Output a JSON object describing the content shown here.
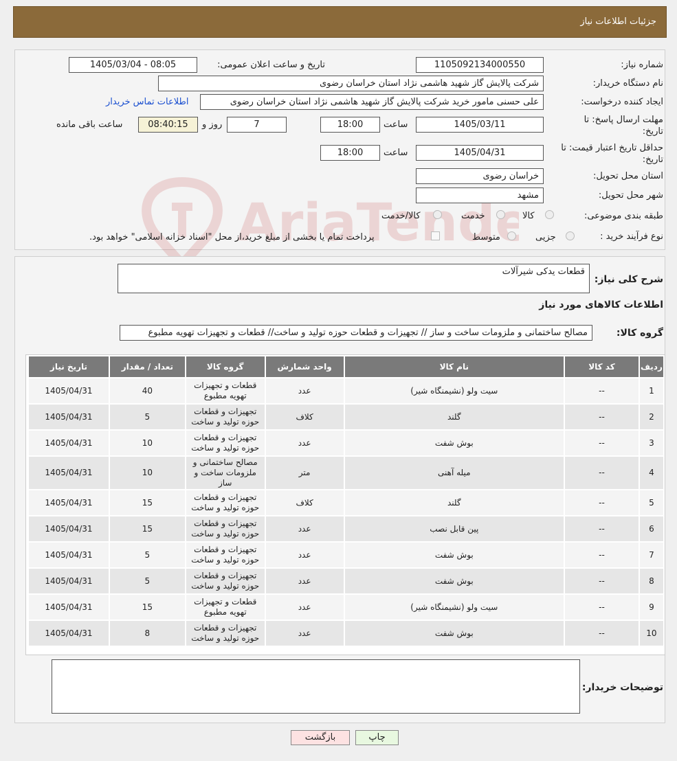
{
  "header": {
    "title": "جزئیات اطلاعات نیاز"
  },
  "info": {
    "need_no_label": "شماره نیاز:",
    "need_no": "1105092134000550",
    "announce_label": "تاریخ و ساعت اعلان عمومی:",
    "announce_value": "1405/03/04 - 08:05",
    "buyer_label": "نام دستگاه خریدار:",
    "buyer_value": "شرکت پالایش گاز شهید هاشمی نژاد   استان خراسان رضوی",
    "creator_label": "ایجاد کننده درخواست:",
    "creator_value": "علی حسنی مامور خرید شرکت پالایش گاز شهید هاشمی نژاد   استان خراسان رضوی",
    "contact_link": "اطلاعات تماس خریدار",
    "deadline_label": "مهلت ارسال پاسخ: تا تاریخ:",
    "deadline_date": "1405/03/11",
    "time_label": "ساعت",
    "deadline_time": "18:00",
    "days_value": "7",
    "days_label": "روز و",
    "remaining_value": "08:40:15",
    "remaining_label": "ساعت باقی مانده",
    "validity_label": "حداقل تاریخ اعتبار قیمت: تا تاریخ:",
    "validity_date": "1405/04/31",
    "validity_time": "18:00",
    "province_label": "استان محل تحویل:",
    "province_value": "خراسان رضوی",
    "city_label": "شهر محل تحویل:",
    "city_value": "مشهد",
    "category_label": "طبقه بندی موضوعی:",
    "category_options": [
      "کالا",
      "خدمت",
      "کالا/خدمت"
    ],
    "process_label": "نوع فرآیند خرید :",
    "process_options": [
      "جزیی",
      "متوسط"
    ],
    "process_note": "پرداخت تمام یا بخشی از مبلغ خرید،از محل \"اسناد خزانه اسلامی\" خواهد بود."
  },
  "general": {
    "desc_label": "شرح کلی نیاز:",
    "desc_value": "قطعات یدکی شیرآلات",
    "items_title": "اطلاعات کالاهای مورد نیاز",
    "group_label": "گروه کالا:",
    "group_value": "مصالح ساختمانی و ملزومات ساخت و ساز // تجهیزات و قطعات حوزه تولید و ساخت//  قطعات و تجهیزات تهویه مطبوع",
    "columns": [
      "ردیف",
      "کد کالا",
      "نام کالا",
      "واحد شمارش",
      "گروه کالا",
      "تعداد / مقدار",
      "تاریخ نیاز"
    ],
    "rows": [
      {
        "n": "1",
        "code": "--",
        "name": "سیت ولو (نشیمنگاه شیر)",
        "unit": "عدد",
        "group": "قطعات و تجهیزات تهویه مطبوع",
        "qty": "40",
        "date": "1405/04/31"
      },
      {
        "n": "2",
        "code": "--",
        "name": "گلند",
        "unit": "کلاف",
        "group": "تجهیزات و قطعات حوزه تولید و ساخت",
        "qty": "5",
        "date": "1405/04/31"
      },
      {
        "n": "3",
        "code": "--",
        "name": "بوش شفت",
        "unit": "عدد",
        "group": "تجهیزات و قطعات حوزه تولید و ساخت",
        "qty": "10",
        "date": "1405/04/31"
      },
      {
        "n": "4",
        "code": "--",
        "name": "میله آهنی",
        "unit": "متر",
        "group": "مصالح ساختمانی و ملزومات ساخت و ساز",
        "qty": "10",
        "date": "1405/04/31"
      },
      {
        "n": "5",
        "code": "--",
        "name": "گلند",
        "unit": "کلاف",
        "group": "تجهیزات و قطعات حوزه تولید و ساخت",
        "qty": "15",
        "date": "1405/04/31"
      },
      {
        "n": "6",
        "code": "--",
        "name": "پین قابل نصب",
        "unit": "عدد",
        "group": "تجهیزات و قطعات حوزه تولید و ساخت",
        "qty": "15",
        "date": "1405/04/31"
      },
      {
        "n": "7",
        "code": "--",
        "name": "بوش شفت",
        "unit": "عدد",
        "group": "تجهیزات و قطعات حوزه تولید و ساخت",
        "qty": "5",
        "date": "1405/04/31"
      },
      {
        "n": "8",
        "code": "--",
        "name": "بوش شفت",
        "unit": "عدد",
        "group": "تجهیزات و قطعات حوزه تولید و ساخت",
        "qty": "5",
        "date": "1405/04/31"
      },
      {
        "n": "9",
        "code": "--",
        "name": "سیت ولو (نشیمنگاه شیر)",
        "unit": "عدد",
        "group": "قطعات و تجهیزات تهویه مطبوع",
        "qty": "15",
        "date": "1405/04/31"
      },
      {
        "n": "10",
        "code": "--",
        "name": "بوش شفت",
        "unit": "عدد",
        "group": "تجهیزات و قطعات حوزه تولید و ساخت",
        "qty": "8",
        "date": "1405/04/31"
      }
    ],
    "buyer_notes_label": "توضیحات خریدار:",
    "buyer_notes_value": ""
  },
  "buttons": {
    "print": "چاپ",
    "back": "بازگشت"
  },
  "watermark": {
    "text": "AriaTender.neT",
    "color": "#c84a4a"
  }
}
